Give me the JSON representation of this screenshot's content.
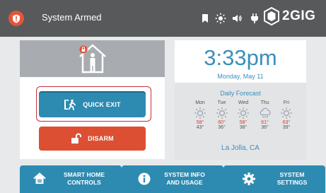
{
  "header": {
    "status": "System Armed",
    "brand": "2GIG",
    "icons": [
      "shield-alert-icon",
      "bookmark-icon",
      "brightness-icon",
      "volume-icon",
      "plug-icon",
      "2gig-logo-icon"
    ]
  },
  "actions": {
    "quick_exit_label": "QUICK EXIT",
    "disarm_label": "DISARM"
  },
  "clock": {
    "time": "3:33pm",
    "date": "Monday, May 11"
  },
  "forecast": {
    "title": "Daily Forecast",
    "days": [
      {
        "name": "Mon",
        "icon": "sun-icon",
        "high": "58°",
        "low": "43°"
      },
      {
        "name": "Tue",
        "icon": "sun-icon",
        "high": "60°",
        "low": "36°"
      },
      {
        "name": "Wed",
        "icon": "sun-icon",
        "high": "58°",
        "low": "38°"
      },
      {
        "name": "Thu",
        "icon": "rain-icon",
        "high": "61°",
        "low": "36°"
      },
      {
        "name": "Fri",
        "icon": "sun-icon",
        "high": "63°",
        "low": "39°"
      }
    ],
    "location": "La Jolla, CA"
  },
  "bottom_nav": [
    {
      "line1": "SMART HOME",
      "line2": "CONTROLS",
      "icon": "home-icon"
    },
    {
      "line1": "SYSTEM INFO",
      "line2": "AND USAGE",
      "icon": "info-icon"
    },
    {
      "line1": "SYSTEM",
      "line2": "SETTINGS",
      "icon": "gear-icon"
    }
  ],
  "colors": {
    "accent_blue": "#2d8bb1",
    "alert_red": "#dc4f33",
    "header_gray": "#58595b"
  }
}
